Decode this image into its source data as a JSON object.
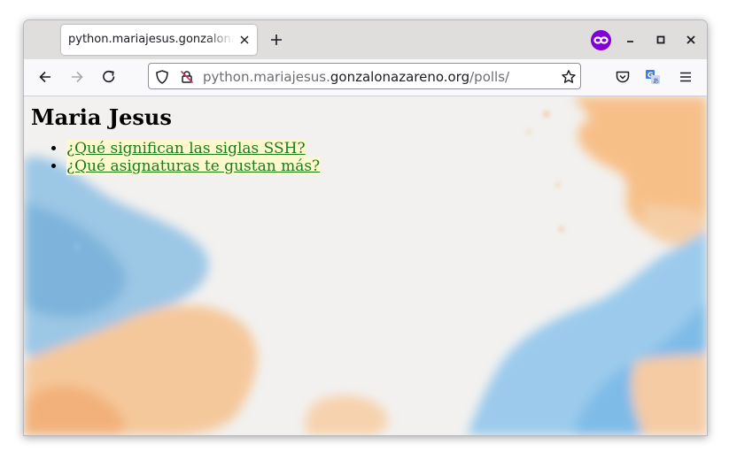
{
  "browser": {
    "tab": {
      "title": "python.mariajesus.gonzalonazareno.org/polls/"
    },
    "url": {
      "host_prefix": "python.mariajesus.",
      "host_domain": "gonzalonazareno.org",
      "path": "/polls/"
    },
    "colors": {
      "private_badge": "#8000d7",
      "link": "#197c1a",
      "link_bg": "#fff8cf"
    }
  },
  "page": {
    "heading": "Maria Jesus",
    "polls": [
      {
        "text": "¿Qué significan las siglas SSH?"
      },
      {
        "text": "¿Qué asignaturas te gustan más?"
      }
    ]
  }
}
